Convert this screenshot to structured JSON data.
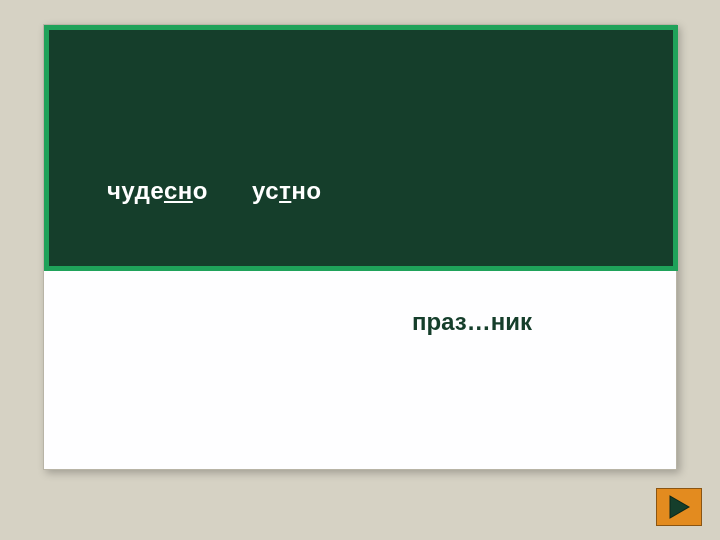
{
  "board": {
    "words": [
      {
        "pre": "чуде",
        "ul": "сн",
        "post": "о"
      },
      {
        "pre": "ус",
        "ul": "т",
        "post": "но"
      }
    ]
  },
  "prompt": {
    "text": "праз…ник"
  },
  "nav": {
    "next_icon": "play-triangle"
  },
  "colors": {
    "bg": "#d6d2c4",
    "card": "#fefeff",
    "board": "#153e2b",
    "board_border": "#1fa25a",
    "accent": "#e38b1f"
  }
}
